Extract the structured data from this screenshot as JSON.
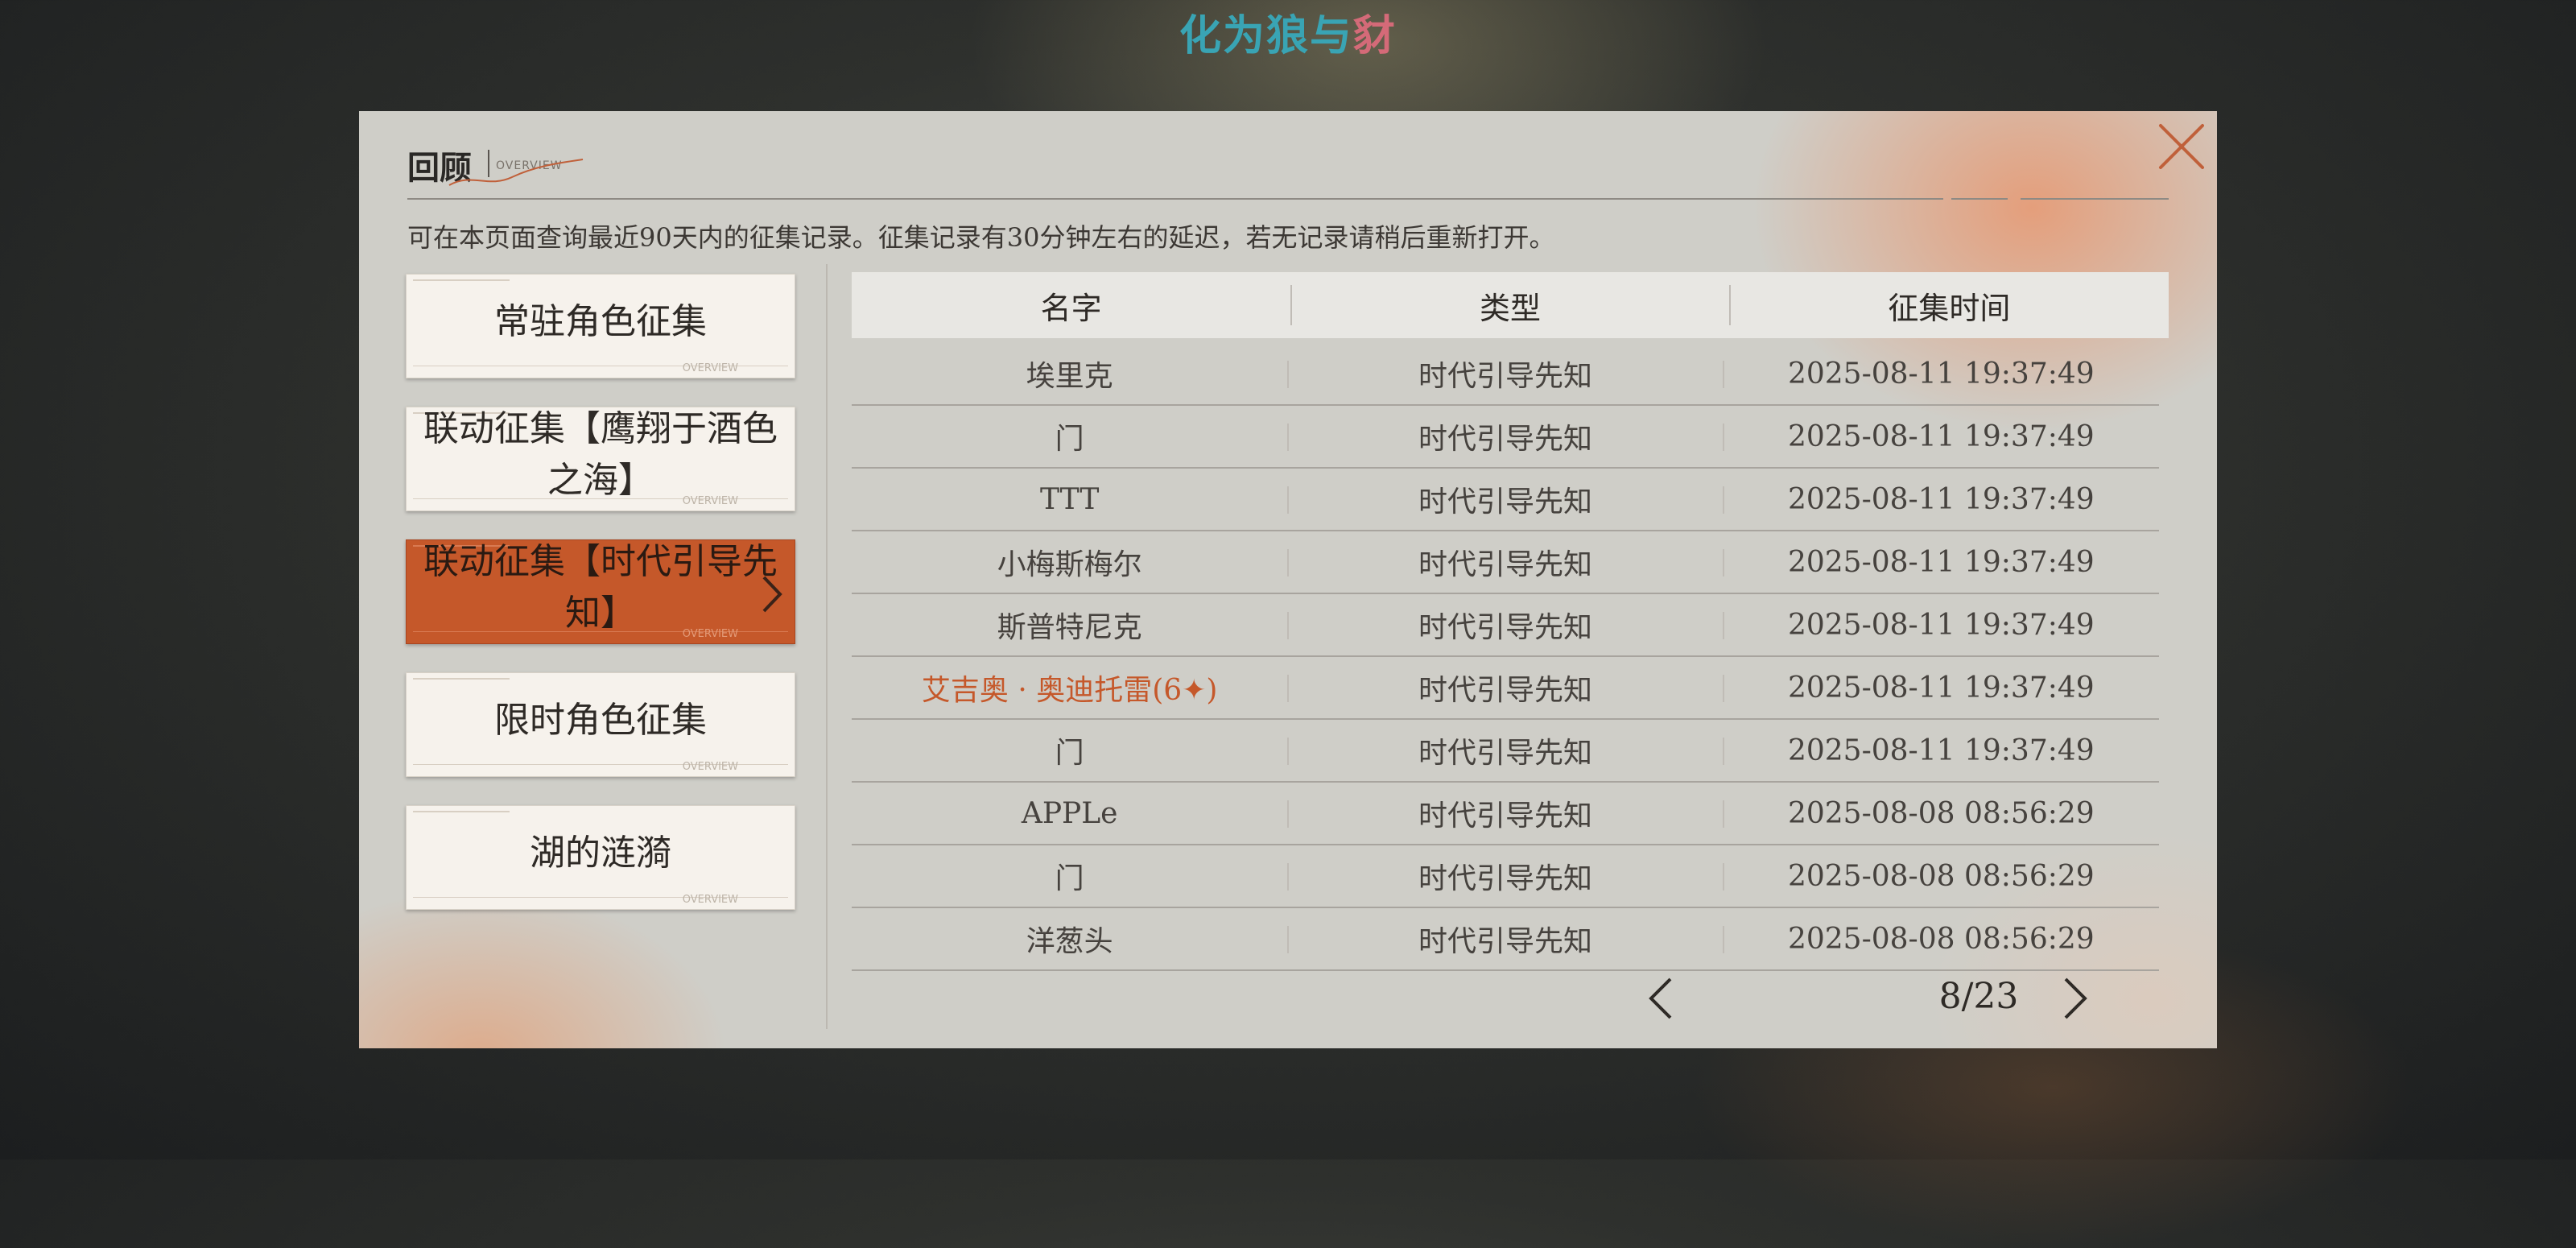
{
  "logo": {
    "part1": "化为狼与",
    "part2": "豺"
  },
  "dialog": {
    "title": "回顾",
    "title_en": "OVERVIEW",
    "notice": "可在本页面查询最近90天内的征集记录。征集记录有30分钟左右的延迟，若无记录请稍后重新打开。",
    "close_icon": "close-icon"
  },
  "categories": [
    {
      "label": "常驻角色征集",
      "active": false
    },
    {
      "label": "联动征集【鹰翔于酒色之海】",
      "active": false
    },
    {
      "label": "联动征集【时代引导先知】",
      "active": true
    },
    {
      "label": "限时角色征集",
      "active": false
    },
    {
      "label": "湖的涟漪",
      "active": false
    }
  ],
  "card_deco_en": "OVERVIEW",
  "table": {
    "headers": [
      "名字",
      "类型",
      "征集时间"
    ],
    "rows": [
      {
        "name": "埃里克",
        "type": "时代引导先知",
        "time": "2025-08-11 19:37:49",
        "rare": false
      },
      {
        "name": "门",
        "type": "时代引导先知",
        "time": "2025-08-11 19:37:49",
        "rare": false
      },
      {
        "name": "TTT",
        "type": "时代引导先知",
        "time": "2025-08-11 19:37:49",
        "rare": false
      },
      {
        "name": "小梅斯梅尔",
        "type": "时代引导先知",
        "time": "2025-08-11 19:37:49",
        "rare": false
      },
      {
        "name": "斯普特尼克",
        "type": "时代引导先知",
        "time": "2025-08-11 19:37:49",
        "rare": false
      },
      {
        "name": "艾吉奥 · 奥迪托雷(6✦)",
        "type": "时代引导先知",
        "time": "2025-08-11 19:37:49",
        "rare": true
      },
      {
        "name": "门",
        "type": "时代引导先知",
        "time": "2025-08-11 19:37:49",
        "rare": false
      },
      {
        "name": "APPLe",
        "type": "时代引导先知",
        "time": "2025-08-08 08:56:29",
        "rare": false
      },
      {
        "name": "门",
        "type": "时代引导先知",
        "time": "2025-08-08 08:56:29",
        "rare": false
      },
      {
        "name": "洋葱头",
        "type": "时代引导先知",
        "time": "2025-08-08 08:56:29",
        "rare": false
      }
    ]
  },
  "pagination": {
    "text": "8/23",
    "prev_icon": "chevron-left-icon",
    "next_icon": "chevron-right-icon"
  },
  "colors": {
    "accent": "#c5582a",
    "logo_teal": "#39a4b4",
    "logo_red": "#d46a78",
    "panel": "#cfcec8"
  }
}
